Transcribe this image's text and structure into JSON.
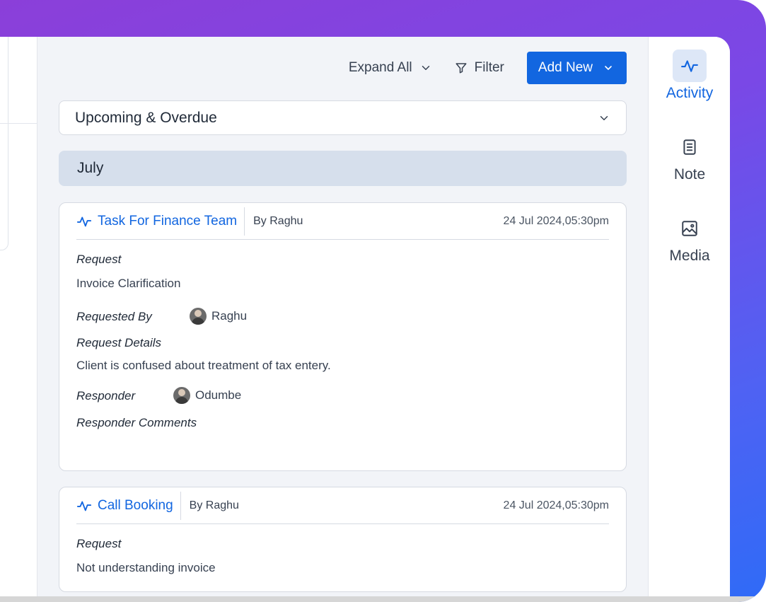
{
  "toolbar": {
    "expand_all_label": "Expand All",
    "filter_label": "Filter",
    "add_new_label": "Add New"
  },
  "view_select": {
    "value": "Upcoming & Overdue"
  },
  "month_header": "July",
  "cards": [
    {
      "title": "Task For Finance Team",
      "by": "By Raghu",
      "timestamp": "24 Jul 2024,05:30pm",
      "request_label": "Request",
      "request_value": "Invoice Clarification",
      "requested_by_label": "Requested By",
      "requested_by_name": "Raghu",
      "request_details_label": "Request Details",
      "request_details_value": "Client is confused about treatment of tax entery.",
      "responder_label": "Responder",
      "responder_name": "Odumbe",
      "responder_comments_label": "Responder Comments"
    },
    {
      "title": "Call Booking",
      "by": "By Raghu",
      "timestamp": "24 Jul 2024,05:30pm",
      "request_label": "Request",
      "request_value": "Not understanding invoice"
    }
  ],
  "rail": {
    "items": [
      {
        "label": "Activity",
        "icon": "activity-icon",
        "active": true
      },
      {
        "label": "Note",
        "icon": "note-icon",
        "active": false
      },
      {
        "label": "Media",
        "icon": "image-icon",
        "active": false
      }
    ]
  },
  "colors": {
    "accent": "#1266e0",
    "month_bg": "#d6dfec",
    "frame_gradient_start": "#8b3fd9",
    "frame_gradient_end": "#2f6bf7"
  }
}
